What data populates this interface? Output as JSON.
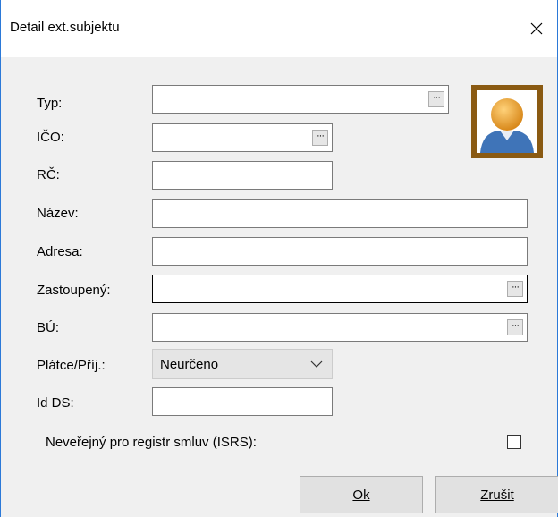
{
  "window": {
    "title": "Detail ext.subjektu",
    "close_glyph": "✕"
  },
  "form": {
    "typ": {
      "label": "Typ:",
      "value": ""
    },
    "ico": {
      "label": "IČO:",
      "value": ""
    },
    "rc": {
      "label": "RČ:",
      "value": ""
    },
    "nazev": {
      "label": "Název:",
      "value": ""
    },
    "adresa": {
      "label": "Adresa:",
      "value": ""
    },
    "zastoupeny": {
      "label": "Zastoupený:",
      "value": ""
    },
    "bu": {
      "label": "BÚ:",
      "value": ""
    },
    "platce": {
      "label": "Plátce/Příj.:",
      "selected": "Neurčeno"
    },
    "id_ds": {
      "label": "Id DS:",
      "value": ""
    },
    "neverejny": {
      "label": "Neveřejný pro registr smluv (ISRS):",
      "checked": false
    },
    "browse_glyph": "···"
  },
  "photo": {
    "icon": "user-avatar-icon",
    "frame_color": "#8a5a12"
  },
  "buttons": {
    "ok_label": "Ok",
    "cancel_label": "Zrušit"
  }
}
